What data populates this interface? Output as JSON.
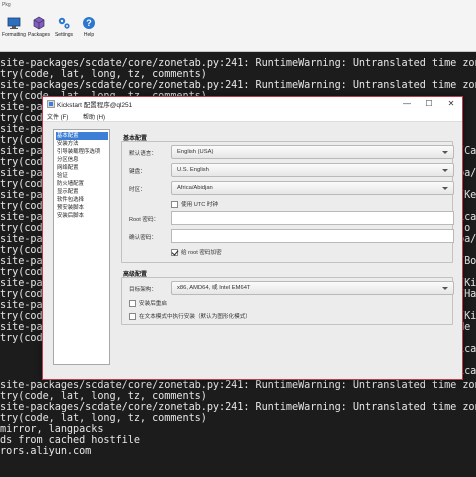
{
  "host_toolbar": {
    "tiny_label": "Pkg",
    "buttons": [
      {
        "label": "Formatting",
        "icon": "monitor-icon"
      },
      {
        "label": "Packages",
        "icon": "packages-icon"
      },
      {
        "label": "Settings",
        "icon": "settings-icon"
      },
      {
        "label": "Help",
        "icon": "help-icon"
      }
    ]
  },
  "terminal": {
    "lines": [
      "site-packages/scdate/core/zonetab.py:241: RuntimeWarning: Untranslated time zone: America/Fo",
      "try(code, lat, long, tz, comments)",
      "site-packages/scdate/core/zonetab.py:241: RuntimeWarning: Untranslated time zone: America/Pu",
      "try(code, lat, long, tz, comments)",
      "site-packag",
      "try(code, l",
      "site-packag",
      "try(code, l",
      "site-packag",
      "try(code, l",
      "site-packag",
      "try(code, l",
      "site-packag",
      "try(code, l",
      "site-packag",
      "try(code, l",
      "site-packag",
      "try(code, l",
      "site-packag",
      "try(code, l",
      "site-packag",
      "try(code, l",
      "site-packag",
      "try(code, l",
      "site-packag",
      "try(code, l",
      "site-packages/scdate/core/zonetab.py:241: RuntimeWarning: Untranslated time zone: Asia/Ust-N",
      "try(code, lat, long, tz, comments)",
      "site-packages/scdate/core/zonetab.py:241: RuntimeWarning: Untranslated time zone: Asia/Sredn",
      "try(code, lat, long, tz, comments)",
      "mirror, langpacks",
      "ds from cached hostfile",
      "rors.aliyun.com"
    ],
    "right_edge": [
      "/Ca",
      "pa/",
      "/Ke",
      "ica",
      "jo",
      "pa/",
      "/Bo",
      "/Ki",
      "/Ha",
      "/Ki",
      "Ne",
      "ica",
      "ica"
    ]
  },
  "dialog": {
    "title": "Kickstart 配置程序@ql251",
    "controls": {
      "minimize": "—",
      "maximize": "☐",
      "close": "✕"
    },
    "menu": [
      "文件 (F)",
      "帮助 (H)"
    ],
    "nav_items": [
      "基本配置",
      "安装方法",
      "引导装载程序选项",
      "分区信息",
      "网络配置",
      "验证",
      "防火墙配置",
      "显示配置",
      "软件包选择",
      "预安装脚本",
      "安装后脚本"
    ],
    "basic": {
      "section_title": "基本配置",
      "default_language_label": "默认语言：",
      "default_language_value": "English (USA)",
      "keyboard_label": "键盘：",
      "keyboard_value": "U.S. English",
      "timezone_label": "时区：",
      "timezone_value": "Africa/Abidjan",
      "utc_label": "使用 UTC 时钟",
      "root_password_label": "Root 密码：",
      "confirm_password_label": "确认密码：",
      "encrypt_label": "给 root 密码加密"
    },
    "advanced": {
      "section_title": "高级配置",
      "target_arch_label": "目标架构：",
      "target_arch_value": "x86, AMD64, 或 Intel EM64T",
      "reboot_label": "安装后重启",
      "text_mode_label": "在文本模式中执行安装（默认为图形化模式）"
    }
  }
}
